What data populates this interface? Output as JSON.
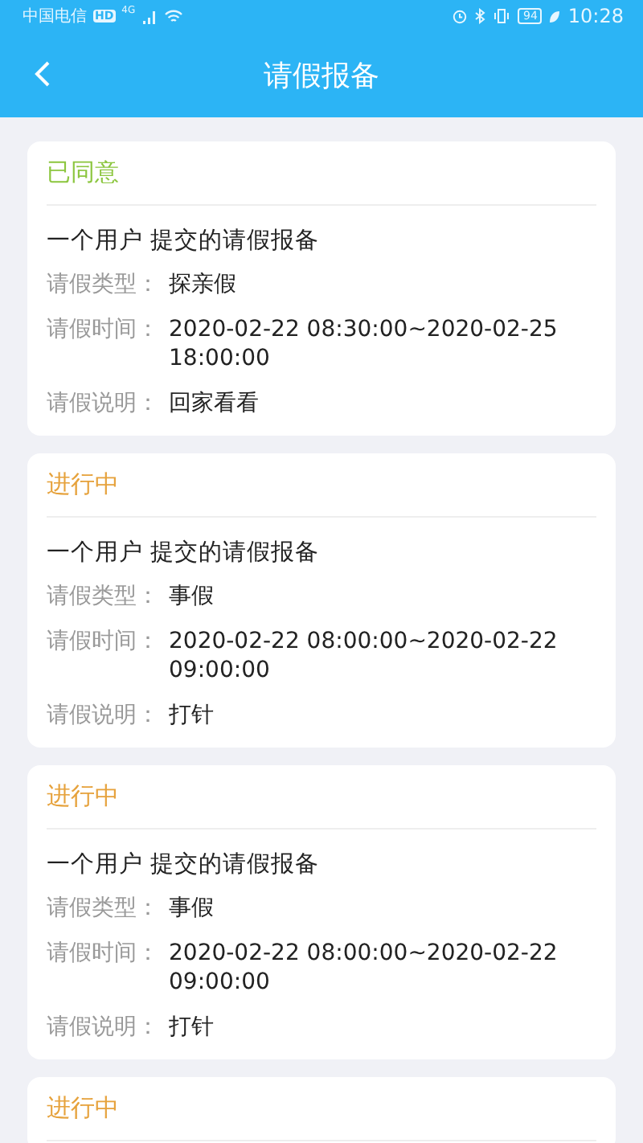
{
  "status_bar": {
    "carrier": "中国电信",
    "hd": "HD",
    "network": "4G",
    "battery": "94",
    "time": "10:28"
  },
  "header": {
    "title": "请假报备"
  },
  "cards": [
    {
      "status": {
        "text": "已同意",
        "kind": "approved"
      },
      "title": "一个用户 提交的请假报备",
      "fields": [
        {
          "label": "请假类型：",
          "value": "探亲假"
        },
        {
          "label": "请假时间：",
          "value": "2020-02-22 08:30:00~2020-02-25 18:00:00"
        },
        {
          "label": "请假说明：",
          "value": "回家看看"
        }
      ]
    },
    {
      "status": {
        "text": "进行中",
        "kind": "pending"
      },
      "title": "一个用户 提交的请假报备",
      "fields": [
        {
          "label": "请假类型：",
          "value": "事假"
        },
        {
          "label": "请假时间：",
          "value": "2020-02-22 08:00:00~2020-02-22 09:00:00"
        },
        {
          "label": "请假说明：",
          "value": "打针"
        }
      ]
    },
    {
      "status": {
        "text": "进行中",
        "kind": "pending"
      },
      "title": "一个用户 提交的请假报备",
      "fields": [
        {
          "label": "请假类型：",
          "value": "事假"
        },
        {
          "label": "请假时间：",
          "value": "2020-02-22 08:00:00~2020-02-22 09:00:00"
        },
        {
          "label": "请假说明：",
          "value": "打针"
        }
      ]
    },
    {
      "status": {
        "text": "进行中",
        "kind": "pending"
      }
    }
  ]
}
